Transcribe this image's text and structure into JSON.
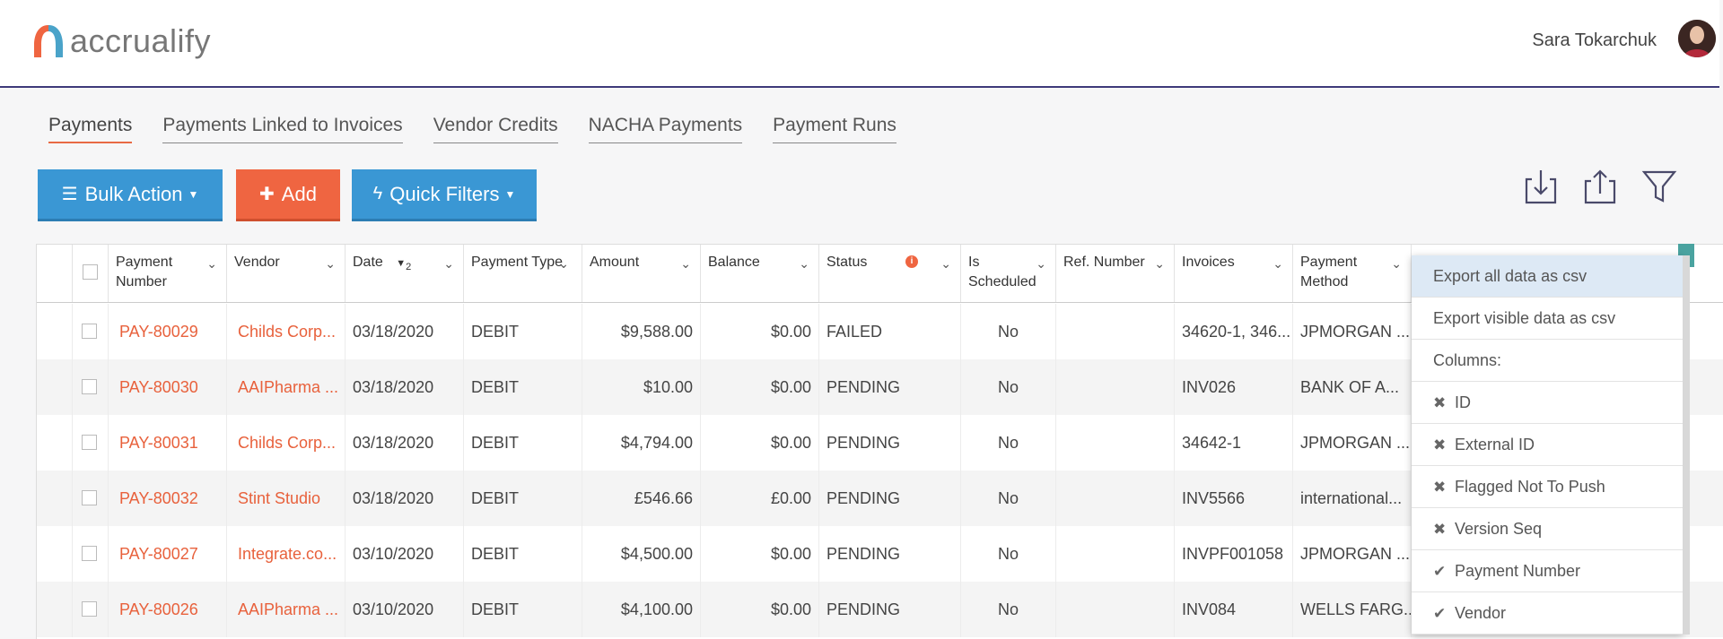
{
  "app": {
    "logo_text": "accrualify",
    "user_name": "Sara Tokarchuk"
  },
  "tabs": [
    {
      "label": "Payments",
      "active": true
    },
    {
      "label": "Payments Linked to Invoices",
      "active": false
    },
    {
      "label": "Vendor Credits",
      "active": false
    },
    {
      "label": "NACHA Payments",
      "active": false
    },
    {
      "label": "Payment Runs",
      "active": false
    }
  ],
  "toolbar": {
    "bulk_action": "Bulk Action",
    "add": "Add",
    "quick_filters": "Quick Filters"
  },
  "table": {
    "columns": [
      {
        "label": "Payment Number"
      },
      {
        "label": "Vendor"
      },
      {
        "label": "Date",
        "sort_order": "2"
      },
      {
        "label": "Payment Type"
      },
      {
        "label": "Amount"
      },
      {
        "label": "Balance"
      },
      {
        "label": "Status"
      },
      {
        "label": "Is Scheduled"
      },
      {
        "label": "Ref. Number"
      },
      {
        "label": "Invoices"
      },
      {
        "label": "Payment Method"
      }
    ],
    "rows": [
      {
        "payment_number": "PAY-80029",
        "vendor": "Childs Corp...",
        "date": "03/18/2020",
        "type": "DEBIT",
        "amount": "$9,588.00",
        "balance": "$0.00",
        "status": "FAILED",
        "scheduled": "No",
        "ref": "",
        "invoices": "34620-1, 346...",
        "method": "JPMORGAN ..."
      },
      {
        "payment_number": "PAY-80030",
        "vendor": "AAIPharma ...",
        "date": "03/18/2020",
        "type": "DEBIT",
        "amount": "$10.00",
        "balance": "$0.00",
        "status": "PENDING",
        "scheduled": "No",
        "ref": "",
        "invoices": "INV026",
        "method": "BANK OF A..."
      },
      {
        "payment_number": "PAY-80031",
        "vendor": "Childs Corp...",
        "date": "03/18/2020",
        "type": "DEBIT",
        "amount": "$4,794.00",
        "balance": "$0.00",
        "status": "PENDING",
        "scheduled": "No",
        "ref": "",
        "invoices": "34642-1",
        "method": "JPMORGAN ..."
      },
      {
        "payment_number": "PAY-80032",
        "vendor": "Stint Studio",
        "date": "03/18/2020",
        "type": "DEBIT",
        "amount": "£546.66",
        "balance": "£0.00",
        "status": "PENDING",
        "scheduled": "No",
        "ref": "",
        "invoices": "INV5566",
        "method": "international..."
      },
      {
        "payment_number": "PAY-80027",
        "vendor": "Integrate.co...",
        "date": "03/10/2020",
        "type": "DEBIT",
        "amount": "$4,500.00",
        "balance": "$0.00",
        "status": "PENDING",
        "scheduled": "No",
        "ref": "",
        "invoices": "INVPF001058",
        "method": "JPMORGAN ..."
      },
      {
        "payment_number": "PAY-80026",
        "vendor": "AAIPharma ...",
        "date": "03/10/2020",
        "type": "DEBIT",
        "amount": "$4,100.00",
        "balance": "$0.00",
        "status": "PENDING",
        "scheduled": "No",
        "ref": "",
        "invoices": "INV084",
        "method": "WELLS FARG..."
      }
    ]
  },
  "export_menu": {
    "export_all": "Export all data as csv",
    "export_visible": "Export visible data as csv",
    "columns_label": "Columns:",
    "columns": [
      {
        "label": "ID",
        "checked": false
      },
      {
        "label": "External ID",
        "checked": false
      },
      {
        "label": "Flagged Not To Push",
        "checked": false
      },
      {
        "label": "Version Seq",
        "checked": false
      },
      {
        "label": "Payment Number",
        "checked": true
      },
      {
        "label": "Vendor",
        "checked": true
      }
    ]
  },
  "colors": {
    "accent_orange": "#e8613c",
    "button_blue": "#3a97d4",
    "header_rule": "#3e3a7a"
  }
}
